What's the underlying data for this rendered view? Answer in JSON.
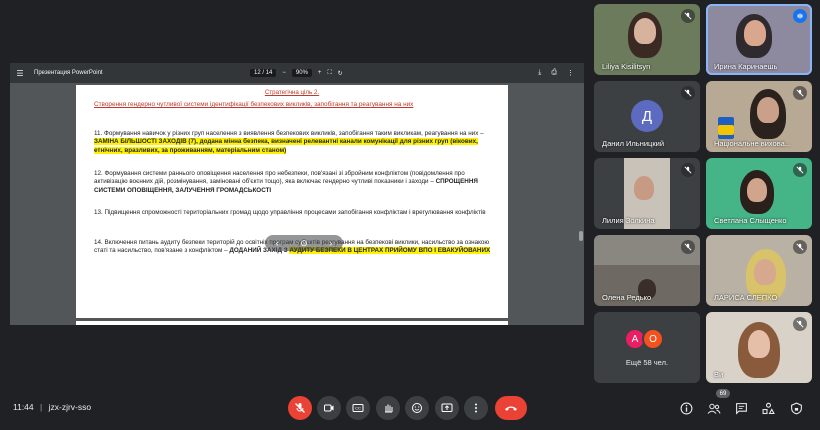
{
  "pdf": {
    "title": "Презентация PowerPoint",
    "page_current": "12",
    "page_sep": "/",
    "page_total": "14",
    "zoom": "90%",
    "menu_icon": "menu-icon"
  },
  "document": {
    "goal_heading": "Стратегічна ціль 2.",
    "goal_subtitle": "Створення гендерно чутливої системи ідентифікації безпекових викликів, запобігання та реагування на них",
    "p11_a": "11. Формування навичок у різних груп населення з виявлення безпекових викликів, запобігання таким викликам, реагування на них – ",
    "p11_hl": "ЗАМІНА БІЛЬШОСТІ ЗАХОДІВ (7), додана мінна безпека, визначені релевантні канали комунікації для різних груп (вікових, етнічних, вразливих, за проживанням, матеріальним станом)",
    "p12_a": "12. Формування системи раннього оповіщення населення про небезпеки, пов'язані зі збройним конфліктом (повідомлення про активізацію воєнних дій, розмінування, заміновані об'єкти тощо), яка включає гендерно чутливі показники і заходи – ",
    "p12_b": "СПРОЩЕННЯ СИСТЕМИ ОПОВІЩЕННЯ, ЗАЛУЧЕННЯ ГРОМАДСЬКОСТІ",
    "p13": "13. Підвищення спроможності територіальних громад щодо управління процесами запобігання конфліктам і врегулювання конфліктів",
    "p14_a": "14. Включення питань аудиту безпеки територій до освітніх програм суб'єктів реагування на безпекові виклики, насильство за ознакою статі та насильство, пов'язане з конфліктом  – ",
    "p14_b": "ДОДАНИЙ ЗАХІД З ",
    "p14_hl": "АУДИТУ БЕЗПЕКИ В ЦЕНТРАХ ПРИЙОМУ ВПО І ЕВАКУЙОВАНИХ"
  },
  "participants": [
    {
      "name": "Liliya Kisilitsyn",
      "muted": true
    },
    {
      "name": "Ирина Каринаешь",
      "muted": false,
      "speaking": true
    },
    {
      "name": "Данил Ильницкий",
      "muted": true,
      "letter": "Д"
    },
    {
      "name": "Національне вихова...",
      "muted": true
    },
    {
      "name": "Лилия Золкина",
      "muted": true
    },
    {
      "name": "Светлана Слыщенко",
      "muted": true
    },
    {
      "name": "Олена Редько",
      "muted": true
    },
    {
      "name": "ЛАРИСА СЛЕПКО",
      "muted": true
    },
    {
      "name": "Ви",
      "muted": true
    }
  ],
  "more": {
    "letters": [
      "А",
      "О"
    ],
    "label": "Ещё 58 чел."
  },
  "bottom": {
    "time": "11:44",
    "separator": "|",
    "meeting_code": "jzx-zjrv-sso",
    "people_count": "69"
  },
  "colors": {
    "accent": "#1a73e8",
    "end_call": "#ea4335",
    "highlight": "#fff200",
    "heading_red": "#c0392b"
  }
}
